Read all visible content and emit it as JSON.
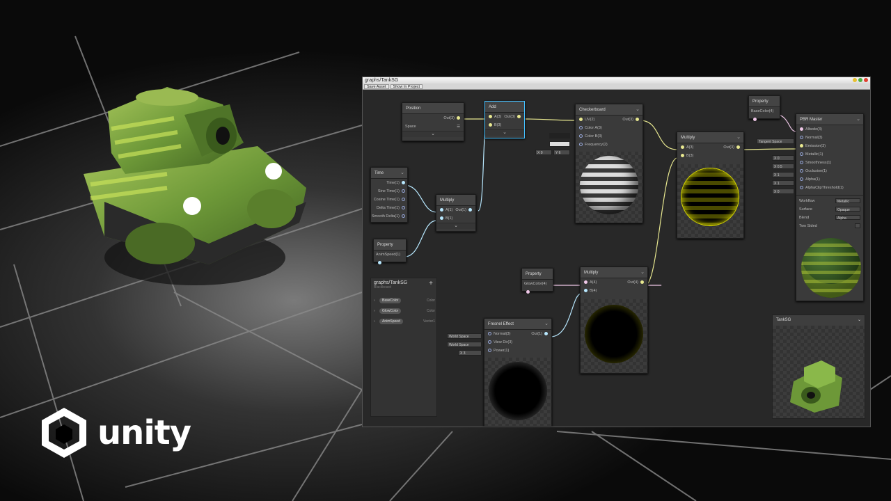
{
  "window": {
    "title": "graphs/TankSG",
    "toolbar": [
      "Save Asset",
      "Show In Project"
    ]
  },
  "nodes": {
    "position": {
      "title": "Position",
      "out": "Out(3)",
      "space_label": "Space",
      "space_value": "☰"
    },
    "add": {
      "title": "Add",
      "in_a": "A(3)",
      "in_b": "B(3)",
      "out": "Out(3)"
    },
    "checkerboard": {
      "title": "Checkerboard",
      "in_uv": "UV(2)",
      "in_ca": "Color A(3)",
      "in_cb": "Color B(3)",
      "in_freq": "Frequency(2)",
      "out": "Out(3)",
      "freq_x": "X 0",
      "freq_y": "Y 6"
    },
    "property_base": {
      "title": "Property",
      "out": "BaseColor(4)"
    },
    "multiply1": {
      "title": "Multiply",
      "in_a": "A(3)",
      "in_b": "B(3)",
      "out": "Out(3)"
    },
    "time": {
      "title": "Time",
      "outs": [
        "Time(1)",
        "Sine Time(1)",
        "Cosine Time(1)",
        "Delta Time(1)",
        "Smooth Delta(1)"
      ]
    },
    "multiply2": {
      "title": "Multiply",
      "in_a": "A(1)",
      "in_b": "B(1)",
      "out": "Out(1)"
    },
    "property_anim": {
      "title": "Property",
      "out": "AnimSpeed(1)"
    },
    "property_glow": {
      "title": "Property",
      "out": "GlowColor(4)"
    },
    "multiply3": {
      "title": "Multiply",
      "in_a": "A(4)",
      "in_b": "B(4)",
      "out": "Out(4)"
    },
    "fresnel": {
      "title": "Fresnel Effect",
      "in_n": "Normal(3)",
      "in_v": "View Dir(3)",
      "in_p": "Power(1)",
      "out": "Out(1)",
      "f_n": "World Space",
      "f_v": "World Space",
      "f_p": "X 3"
    },
    "pbr": {
      "title": "PBR Master",
      "ins": [
        "Albedo(3)",
        "Normal(3)",
        "Emission(3)",
        "Metallic(1)",
        "Smoothness(1)",
        "Occlusion(1)",
        "Alpha(1)",
        "AlphaClipThreshold(1)"
      ],
      "fields": [
        "Tangent Space",
        "X 0",
        "X 0.5",
        "X 1",
        "X 1",
        "X 0"
      ],
      "settings": [
        {
          "label": "Workflow",
          "value": "Metallic"
        },
        {
          "label": "Surface",
          "value": "Opaque"
        },
        {
          "label": "Blend",
          "value": "Alpha"
        },
        {
          "label": "Two Sided",
          "value": ""
        }
      ]
    }
  },
  "blackboard": {
    "title": "graphs/TankSG",
    "subtitle": "Blackboard",
    "items": [
      {
        "name": "BaseColor",
        "type": "Color"
      },
      {
        "name": "GlowColor",
        "type": "Color"
      },
      {
        "name": "AnimSpeed",
        "type": "Vector1"
      }
    ]
  },
  "preview": {
    "title": "TankSG"
  },
  "logo": {
    "text": "unity"
  },
  "colors": {
    "accent": "#44c0ff",
    "yellow": "#e8e800",
    "tank": "#6f9a3a"
  }
}
